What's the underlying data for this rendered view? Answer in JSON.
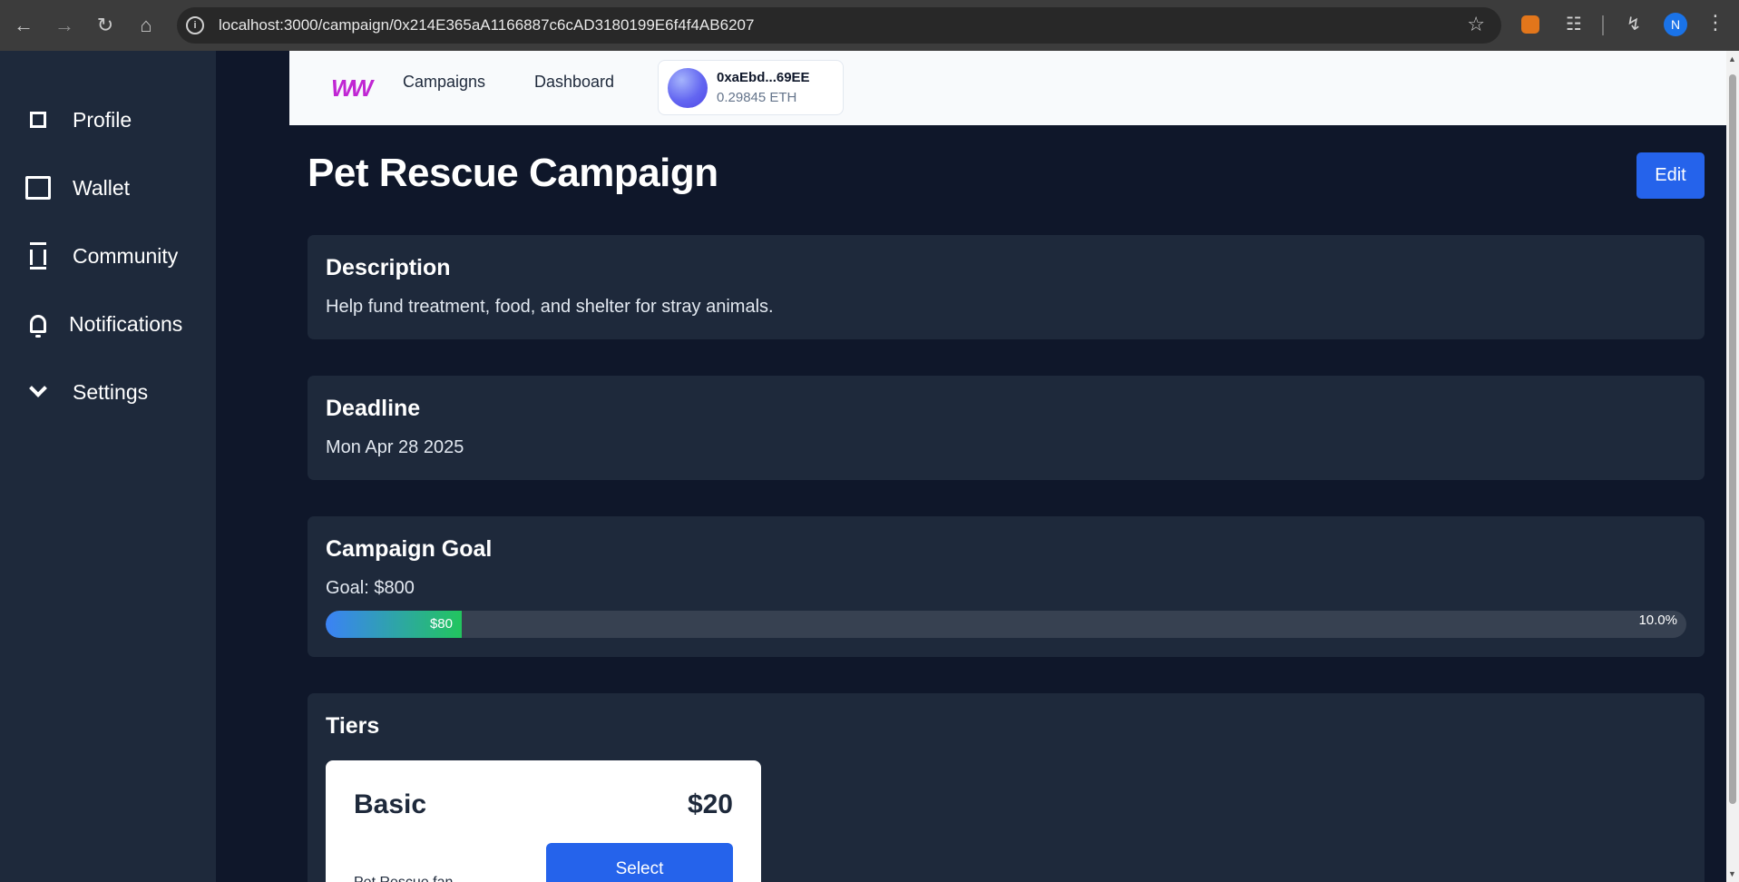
{
  "browser": {
    "url": "localhost:3000/campaign/0x214E365aA1166887c6cAD3180199E6f4f4AB6207",
    "profile_initial": "N"
  },
  "sidebar": {
    "items": [
      {
        "label": "Profile",
        "icon": "square-icon"
      },
      {
        "label": "Wallet",
        "icon": "wallet-icon"
      },
      {
        "label": "Community",
        "icon": "community-icon"
      },
      {
        "label": "Notifications",
        "icon": "bell-icon"
      },
      {
        "label": "Settings",
        "icon": "chevron-down-icon"
      }
    ]
  },
  "header": {
    "logo": "W",
    "nav": [
      {
        "label": "Campaigns"
      },
      {
        "label": "Dashboard"
      }
    ],
    "wallet": {
      "address": "0xaEbd...69EE",
      "balance": "0.29845 ETH"
    }
  },
  "campaign": {
    "title": "Pet Rescue Campaign",
    "edit_label": "Edit",
    "description": {
      "heading": "Description",
      "text": "Help fund treatment, food, and shelter for stray animals."
    },
    "deadline": {
      "heading": "Deadline",
      "text": "Mon Apr 28 2025"
    },
    "goal": {
      "heading": "Campaign Goal",
      "text": "Goal: $800",
      "raised_label": "$80",
      "percent_label": "10.0%",
      "progress_fraction": 0.1
    },
    "tiers": {
      "heading": "Tiers",
      "items": [
        {
          "name": "Basic",
          "price": "$20",
          "select_label": "Select",
          "subtext": "Pet Rescue fan"
        }
      ]
    }
  },
  "colors": {
    "sidebar_bg": "#1e293b",
    "page_bg": "#0f172a",
    "card_bg": "#1e293b",
    "accent": "#2563eb",
    "progress_start": "#3b82f6",
    "progress_end": "#22c55e",
    "logo": "#c026d3"
  }
}
